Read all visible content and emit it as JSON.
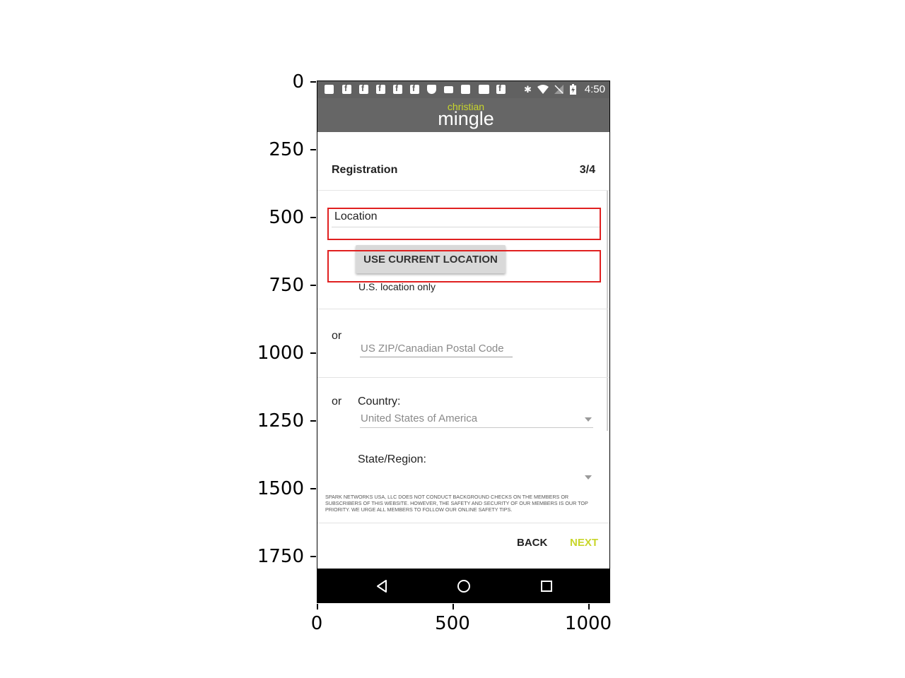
{
  "plot_axes": {
    "y_ticks": [
      "0",
      "250",
      "500",
      "750",
      "1000",
      "1250",
      "1500",
      "1750"
    ],
    "x_ticks": [
      "0",
      "500",
      "1000"
    ]
  },
  "status_bar": {
    "time": "4:50",
    "notification_icons": [
      "message-icon",
      "facebook-icon",
      "facebook-icon",
      "facebook-icon",
      "facebook-icon",
      "facebook-icon",
      "shield-icon",
      "card-icon",
      "bag-icon",
      "news-icon",
      "facebook-icon"
    ],
    "system_icons": [
      "bluetooth-icon",
      "wifi-icon",
      "signal-off-icon",
      "battery-charging-icon"
    ]
  },
  "app_bar": {
    "logo_top": "christian",
    "logo_bottom": "mingle",
    "logo_accent_color": "#c8d62b",
    "background_color": "#666666"
  },
  "header": {
    "title": "Registration",
    "step": "3/4"
  },
  "location": {
    "label": "Location",
    "use_current_button": "USE CURRENT LOCATION",
    "note": "U.S. location only"
  },
  "zip": {
    "or_label": "or",
    "placeholder": "US ZIP/Canadian Postal Code",
    "value": ""
  },
  "country": {
    "or_label": "or",
    "label": "Country:",
    "selected": "United States of America"
  },
  "state": {
    "label": "State/Region:",
    "selected": ""
  },
  "disclaimer": "SPARK NETWORKS USA, LLC DOES NOT CONDUCT BACKGROUND CHECKS ON THE MEMBERS OR SUBSCRIBERS OF THIS WEBSITE. HOWEVER, THE SAFETY AND SECURITY OF OUR MEMBERS IS OUR TOP PRIORITY. WE URGE ALL MEMBERS TO FOLLOW OUR ONLINE SAFETY TIPS.",
  "footer": {
    "back_label": "BACK",
    "next_label": "NEXT",
    "next_color": "#c8d62b"
  },
  "navigation_bar": {
    "buttons": [
      "back-triangle-icon",
      "home-circle-icon",
      "recents-square-icon"
    ]
  },
  "annotation_color": "#e02020"
}
